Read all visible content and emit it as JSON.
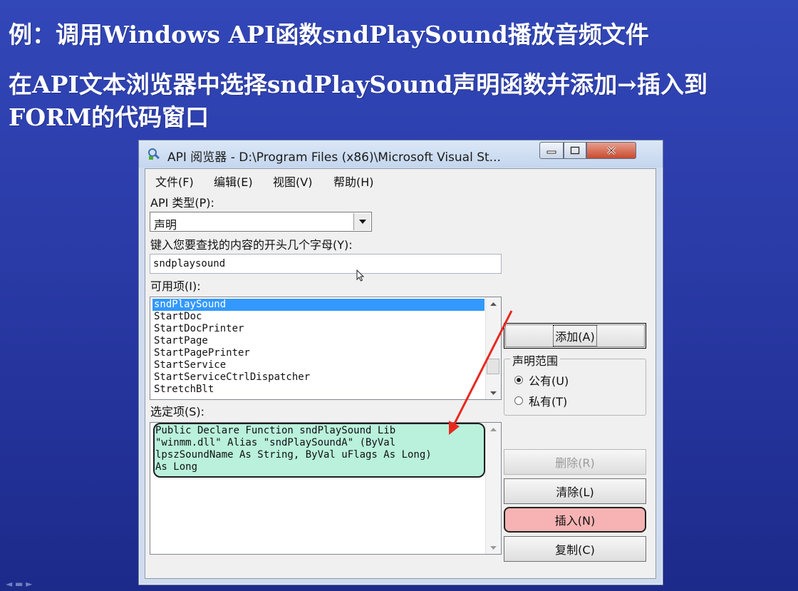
{
  "slide": {
    "line1": "例：调用Windows API函数sndPlaySound播放音频文件",
    "line2": "在API文本浏览器中选择sndPlaySound声明函数并添加→插入到",
    "line3": "FORM的代码窗口"
  },
  "window": {
    "title": "API 阅览器 - D:\\Program Files (x86)\\Microsoft Visual St...",
    "menu": [
      "文件(F)",
      "编辑(E)",
      "视图(V)",
      "帮助(H)"
    ],
    "api_type_label": "API 类型(P):",
    "api_type_value": "声明",
    "search_label": "键入您要查找的内容的开头几个字母(Y):",
    "search_value": "sndplaysound",
    "available_label": "可用项(I):",
    "available_items": [
      "sndPlaySound",
      "StartDoc",
      "StartDocPrinter",
      "StartPage",
      "StartPagePrinter",
      "StartService",
      "StartServiceCtrlDispatcher",
      "StretchBlt"
    ],
    "selected_label": "选定项(S):",
    "selected_code": [
      "Public Declare Function sndPlaySound Lib",
      "\"winmm.dll\" Alias \"sndPlaySoundA\" (ByVal",
      "lpszSoundName As String, ByVal uFlags As Long)",
      "As Long"
    ],
    "buttons": {
      "add": "添加(A)",
      "delete": "删除(R)",
      "clear": "清除(L)",
      "insert": "插入(N)",
      "copy": "复制(C)"
    },
    "scope": {
      "title": "声明范围",
      "public": "公有(U)",
      "private": "私有(T)",
      "selected": "public"
    }
  },
  "colors": {
    "slide_bg": "#2a3aa6",
    "selection": "#3399ff",
    "code_highlight": "#b9f1dc",
    "insert_highlight": "#f7b3b3",
    "annotation_arrow": "#e8281e"
  }
}
